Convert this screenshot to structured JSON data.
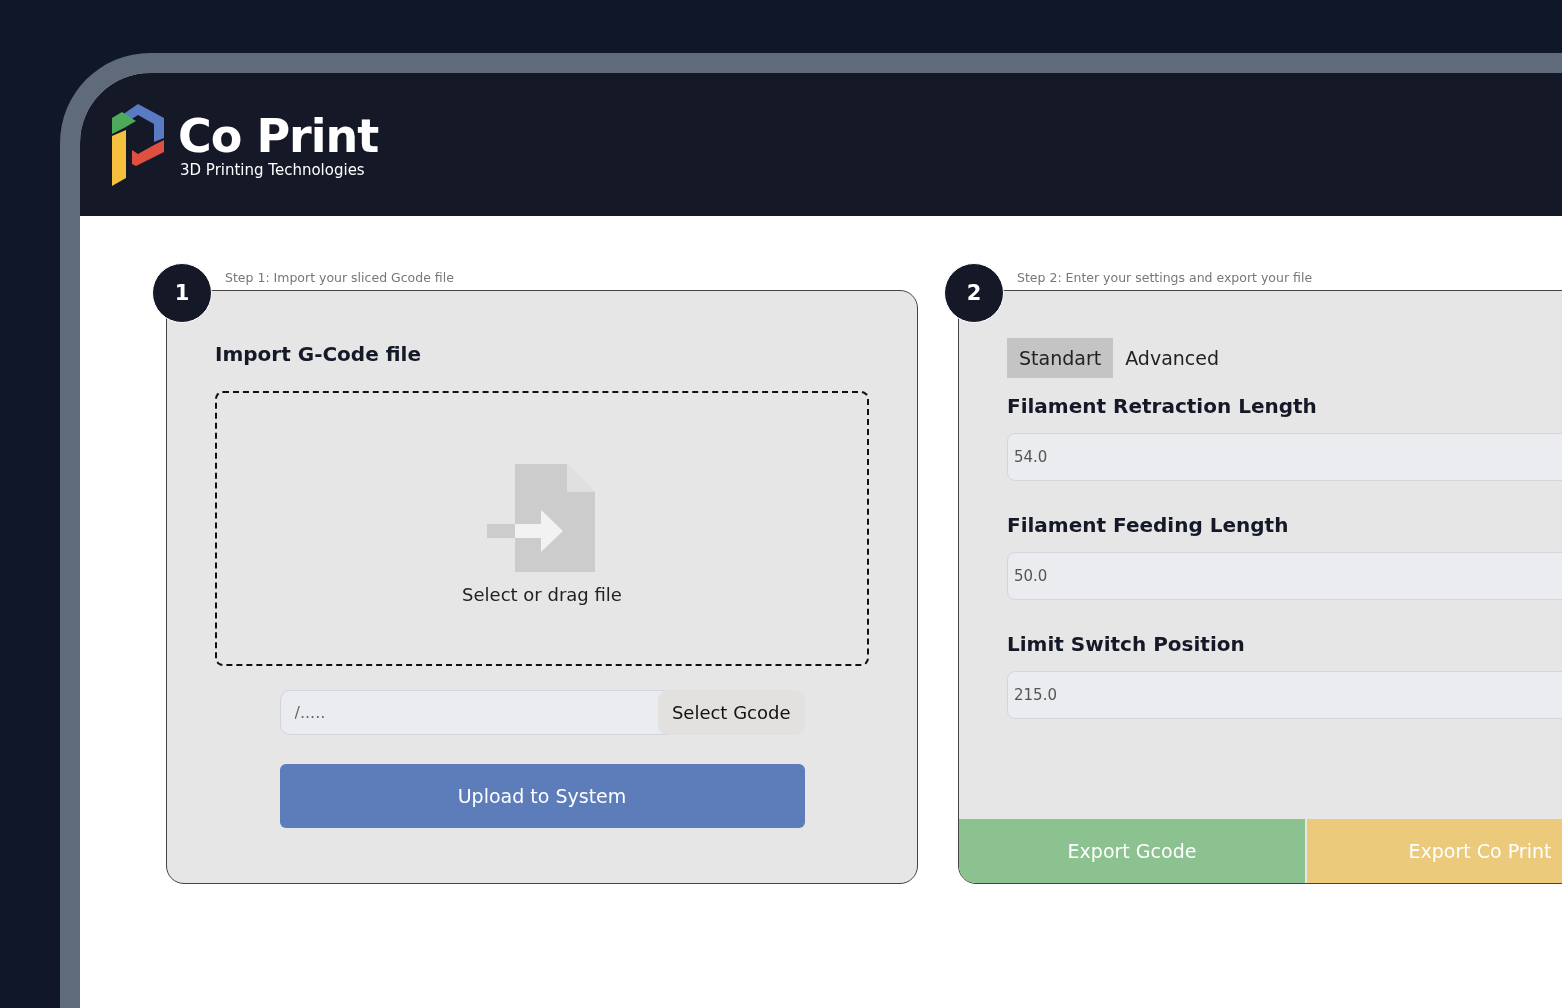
{
  "header": {
    "logo_title": "Co Print",
    "logo_subtitle": "3D Printing Technologies"
  },
  "steps": [
    {
      "number": "1",
      "caption": "Step 1: Import your sliced Gcode file"
    },
    {
      "number": "2",
      "caption": "Step 2: Enter your settings and export your file"
    }
  ],
  "import_panel": {
    "title": "Import G-Code file",
    "dropzone_text": "Select or drag file",
    "file_field": {
      "placeholder": "/.....",
      "button": "Select Gcode"
    },
    "upload_button": "Upload to System"
  },
  "settings_panel": {
    "tabs": [
      {
        "label": "Standart",
        "selected": true
      },
      {
        "label": "Advanced",
        "selected": false
      }
    ],
    "fields": [
      {
        "label": "Filament Retraction Length",
        "value": "54.0"
      },
      {
        "label": "Filament Feeding Length",
        "value": "50.0"
      },
      {
        "label": "Limit Switch Position",
        "value": "215.0"
      }
    ],
    "export_buttons": [
      {
        "label": "Export Gcode",
        "color": "#8cc28f"
      },
      {
        "label": "Export Co Print",
        "color": "#ecca7c"
      }
    ]
  }
}
